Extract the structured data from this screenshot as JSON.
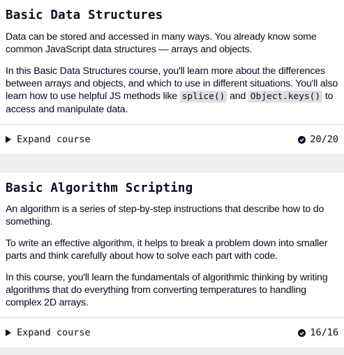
{
  "courses": [
    {
      "title": "Basic Data Structures",
      "paragraphs": {
        "p1": "Data can be stored and accessed in many ways. You already know some common JavaScript data structures — arrays and objects.",
        "p2_part1": "In this Basic Data Structures course, you'll learn more about the differences between arrays and objects, and which to use in different situations. You'll also learn how to use helpful JS methods like",
        "p2_code1": "splice()",
        "p2_part2": "and",
        "p2_code2": "Object.keys()",
        "p2_part3": "to access and manipulate data."
      },
      "expand_label": "Expand course",
      "progress": "20/20"
    },
    {
      "title": "Basic Algorithm Scripting",
      "paragraphs": {
        "p1": "An algorithm is a series of step-by-step instructions that describe how to do something.",
        "p2": "To write an effective algorithm, it helps to break a problem down into smaller parts and think carefully about how to solve each part with code.",
        "p3": "In this course, you'll learn the fundamentals of algorithmic thinking by writing algorithms that do everything from converting temperatures to handling complex 2D arrays."
      },
      "expand_label": "Expand course",
      "progress": "16/16"
    }
  ],
  "colors": {
    "text": "#0a0a23",
    "card_bg": "#ffffff",
    "page_bg": "#eeeef0",
    "code_bg": "#dfdfe2"
  },
  "icons": {
    "expand": "triangle-right-icon",
    "complete": "check-circle-icon"
  }
}
